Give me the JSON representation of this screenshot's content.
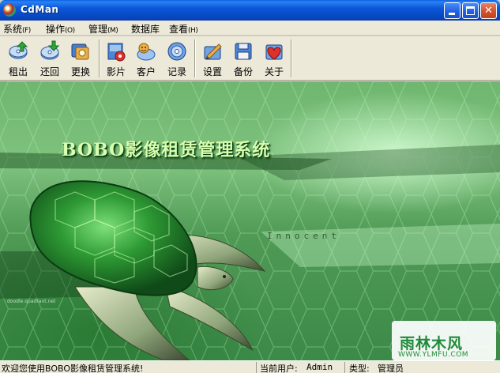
{
  "window": {
    "title": "CdMan",
    "minimize_glyph": "minimize-icon",
    "maximize_glyph": "maximize-icon",
    "close_glyph": "✕"
  },
  "menu": [
    {
      "label": "系统",
      "hotkey": "(F)"
    },
    {
      "label": "操作",
      "hotkey": "(O)"
    },
    {
      "label": "管理",
      "hotkey": "(M)"
    },
    {
      "label": "数据库",
      "hotkey": ""
    },
    {
      "label": "查看",
      "hotkey": "(H)"
    }
  ],
  "toolbar": [
    {
      "label": "租出",
      "icon": "rent-out-icon"
    },
    {
      "label": "还回",
      "icon": "return-icon"
    },
    {
      "label": "更换",
      "icon": "exchange-icon"
    },
    {
      "label": "影片",
      "icon": "film-icon"
    },
    {
      "label": "客户",
      "icon": "customer-icon"
    },
    {
      "label": "记录",
      "icon": "records-icon"
    },
    {
      "label": "设置",
      "icon": "settings-icon"
    },
    {
      "label": "备份",
      "icon": "backup-icon"
    },
    {
      "label": "关于",
      "icon": "about-icon"
    }
  ],
  "banner": {
    "title": "BOBO影像租赁管理系统",
    "subtitle": "Innocent",
    "credit": "doodle.quadrant.net",
    "watermark_main": "雨林木风",
    "watermark_sub": "WWW.YLMFU.COM"
  },
  "status": {
    "welcome": "欢迎您使用BOBO影像租赁管理系统!",
    "user_label": "当前用户:",
    "user_value": "Admin",
    "type_label": "类型:",
    "type_value": "管理员"
  },
  "colors": {
    "titlebar": "#0b58d8",
    "chrome": "#ece9d8",
    "banner_green": "#5aa35f",
    "title_text": "#d9ffb0",
    "watermark_green": "#1f8a3a"
  }
}
